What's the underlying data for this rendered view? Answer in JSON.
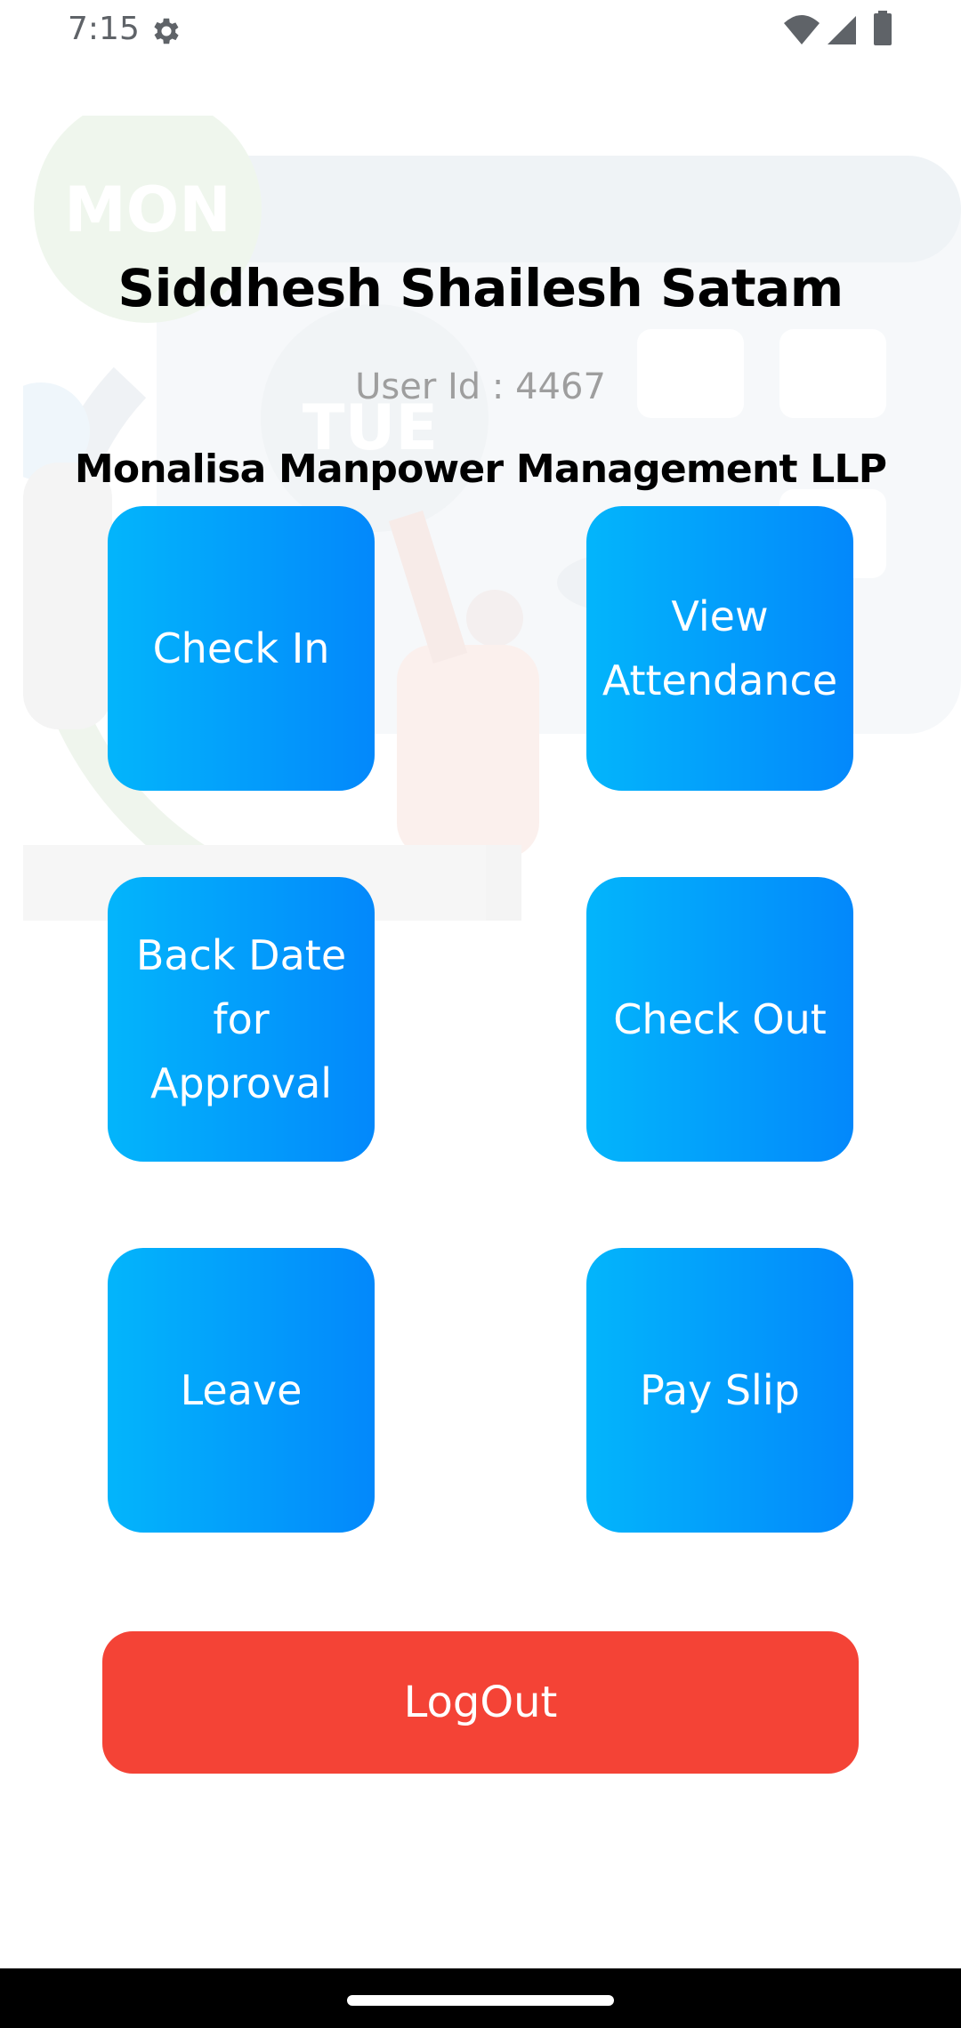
{
  "status_bar": {
    "time": "7:15",
    "icons": [
      "gear-icon",
      "wifi-icon",
      "signal-icon",
      "battery-icon"
    ]
  },
  "background": {
    "day_labels": [
      "MON",
      "TUE"
    ]
  },
  "header": {
    "user_name": "Siddhesh Shailesh Satam",
    "user_id": "User Id : 4467",
    "company": "Monalisa Manpower Management LLP"
  },
  "tiles": {
    "check_in": [
      "Check In"
    ],
    "view_attendance": [
      "View",
      "Attendance"
    ],
    "back_date": [
      "Back Date",
      "for",
      "Approval"
    ],
    "check_out": [
      "Check Out"
    ],
    "leave": [
      "Leave"
    ],
    "pay_slip": [
      "Pay Slip"
    ]
  },
  "logout": {
    "label": "LogOut"
  },
  "colors": {
    "tile_gradient_start": "#03b5fb",
    "tile_gradient_end": "#0388fb",
    "logout": "#f44336",
    "user_id_text": "#9e9e9e"
  }
}
